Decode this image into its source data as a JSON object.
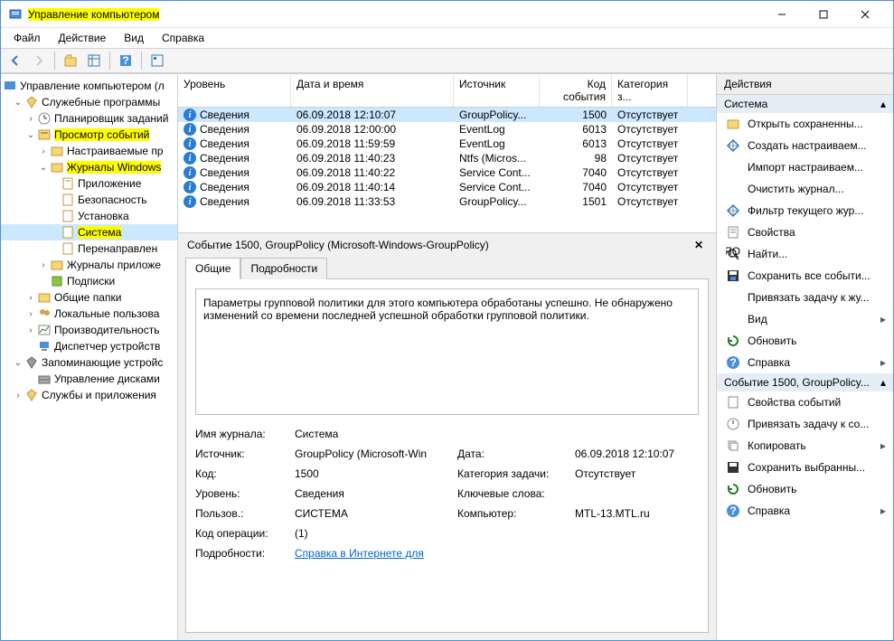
{
  "titlebar": {
    "title": "Управление компьютером"
  },
  "menu": {
    "file": "Файл",
    "action": "Действие",
    "view": "Вид",
    "help": "Справка"
  },
  "tree": {
    "root": "Управление компьютером (л",
    "tools": "Служебные программы",
    "scheduler": "Планировщик заданий",
    "eventviewer": "Просмотр событий",
    "customviews": "Настраиваемые пр",
    "winlogs": "Журналы Windows",
    "app": "Приложение",
    "sec": "Безопасность",
    "setup": "Установка",
    "system": "Система",
    "forwarded": "Перенаправлен",
    "applogs": "Журналы приложе",
    "subs": "Подписки",
    "shared": "Общие папки",
    "localusers": "Локальные пользова",
    "perf": "Производительность",
    "devmgr": "Диспетчер устройств",
    "storage": "Запоминающие устройс",
    "diskmgr": "Управление дисками",
    "services": "Службы и приложения"
  },
  "grid": {
    "headers": {
      "level": "Уровень",
      "date": "Дата и время",
      "source": "Источник",
      "id": "Код события",
      "cat": "Категория з..."
    },
    "rows": [
      {
        "level": "Сведения",
        "date": "06.09.2018 12:10:07",
        "source": "GroupPolicy...",
        "id": "1500",
        "cat": "Отсутствует"
      },
      {
        "level": "Сведения",
        "date": "06.09.2018 12:00:00",
        "source": "EventLog",
        "id": "6013",
        "cat": "Отсутствует"
      },
      {
        "level": "Сведения",
        "date": "06.09.2018 11:59:59",
        "source": "EventLog",
        "id": "6013",
        "cat": "Отсутствует"
      },
      {
        "level": "Сведения",
        "date": "06.09.2018 11:40:23",
        "source": "Ntfs (Micros...",
        "id": "98",
        "cat": "Отсутствует"
      },
      {
        "level": "Сведения",
        "date": "06.09.2018 11:40:22",
        "source": "Service Cont...",
        "id": "7040",
        "cat": "Отсутствует"
      },
      {
        "level": "Сведения",
        "date": "06.09.2018 11:40:14",
        "source": "Service Cont...",
        "id": "7040",
        "cat": "Отсутствует"
      },
      {
        "level": "Сведения",
        "date": "06.09.2018 11:33:53",
        "source": "GroupPolicy...",
        "id": "1501",
        "cat": "Отсутствует"
      }
    ]
  },
  "detail": {
    "title": "Событие 1500, GroupPolicy (Microsoft-Windows-GroupPolicy)",
    "tabs": {
      "general": "Общие",
      "details": "Подробности"
    },
    "message": "Параметры групповой политики для этого компьютера обработаны успешно. Не обнаружено изменений со времени последней успешной обработки групповой политики.",
    "labels": {
      "logname": "Имя журнала:",
      "source": "Источник:",
      "id": "Код:",
      "level": "Уровень:",
      "user": "Пользов.:",
      "opcode": "Код операции:",
      "moreinfo": "Подробности:",
      "date": "Дата:",
      "category": "Категория задачи:",
      "keywords": "Ключевые слова:",
      "computer": "Компьютер:"
    },
    "values": {
      "logname": "Система",
      "source": "GroupPolicy (Microsoft-Win",
      "id": "1500",
      "level": "Сведения",
      "user": "СИСТЕМА",
      "opcode": "(1)",
      "date": "06.09.2018 12:10:07",
      "category": "Отсутствует",
      "keywords": "",
      "computer": "MTL-13.MTL.ru",
      "helplink": "Справка в Интернете для "
    }
  },
  "actions": {
    "header": "Действия",
    "section1": "Система",
    "items1": [
      "Открыть сохраненны...",
      "Создать настраиваем...",
      "Импорт настраиваем...",
      "Очистить журнал...",
      "Фильтр текущего жур...",
      "Свойства",
      "Найти...",
      "Сохранить все событи...",
      "Привязать задачу к жу...",
      "Вид",
      "Обновить",
      "Справка"
    ],
    "section2": "Событие 1500, GroupPolicy...",
    "items2": [
      "Свойства событий",
      "Привязать задачу к со...",
      "Копировать",
      "Сохранить выбранны...",
      "Обновить",
      "Справка"
    ]
  }
}
